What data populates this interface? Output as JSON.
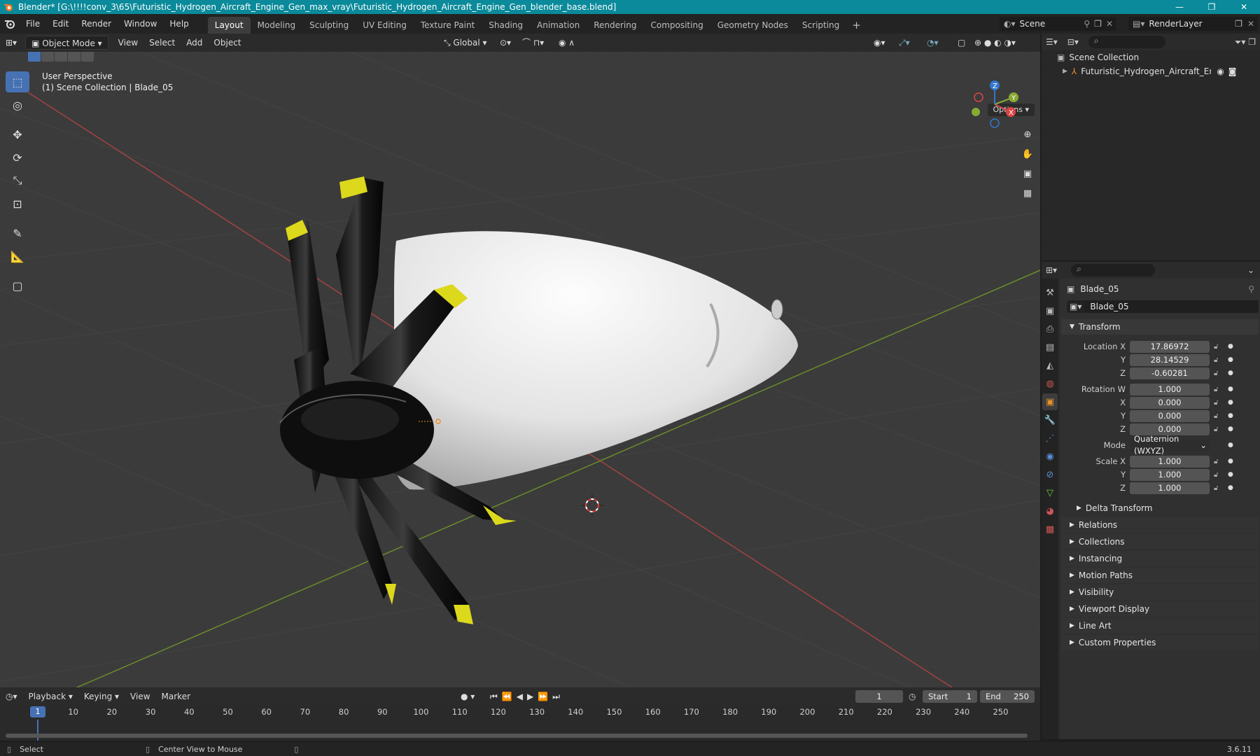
{
  "window": {
    "title": "Blender* [G:\\!!!!conv_3\\65\\Futuristic_Hydrogen_Aircraft_Engine_Gen_max_vray\\Futuristic_Hydrogen_Aircraft_Engine_Gen_blender_base.blend]"
  },
  "menu": [
    "File",
    "Edit",
    "Render",
    "Window",
    "Help"
  ],
  "workspaces": [
    "Layout",
    "Modeling",
    "Sculpting",
    "UV Editing",
    "Texture Paint",
    "Shading",
    "Animation",
    "Rendering",
    "Compositing",
    "Geometry Nodes",
    "Scripting"
  ],
  "active_workspace": "Layout",
  "scene": {
    "name": "Scene",
    "view_layer": "RenderLayer"
  },
  "viewport_header": {
    "mode": "Object Mode",
    "menus": [
      "View",
      "Select",
      "Add",
      "Object"
    ],
    "orientation": "Global",
    "options": "Options"
  },
  "viewport": {
    "perspective": "User Perspective",
    "collection_path": "(1) Scene Collection | Blade_05",
    "gizmo_axes": [
      "X",
      "Y",
      "Z"
    ]
  },
  "outliner": {
    "root": "Scene Collection",
    "item": "Futuristic_Hydrogen_Aircraft_Engine_Ge"
  },
  "properties": {
    "object_name": "Blade_05",
    "data_name": "Blade_05",
    "transform_label": "Transform",
    "location": {
      "label": "Location X",
      "x": "17.86972",
      "y": "28.14529",
      "z": "-0.60281"
    },
    "rotation": {
      "label": "Rotation W",
      "w": "1.000",
      "x": "0.000",
      "y": "0.000",
      "z": "0.000"
    },
    "mode_label": "Mode",
    "mode_value": "Quaternion (WXYZ)",
    "scale": {
      "label": "Scale X",
      "x": "1.000",
      "y": "1.000",
      "z": "1.000"
    },
    "axis_labels": {
      "y": "Y",
      "z": "Z",
      "x": "X"
    },
    "delta": "Delta Transform",
    "panels": [
      "Relations",
      "Collections",
      "Instancing",
      "Motion Paths",
      "Visibility",
      "Viewport Display",
      "Line Art",
      "Custom Properties"
    ]
  },
  "timeline": {
    "menus": [
      "Playback",
      "Keying",
      "View",
      "Marker"
    ],
    "current_frame": "1",
    "start_label": "Start",
    "start": "1",
    "end_label": "End",
    "end": "250",
    "ticks": [
      "1",
      "10",
      "20",
      "30",
      "40",
      "50",
      "60",
      "70",
      "80",
      "90",
      "100",
      "110",
      "120",
      "130",
      "140",
      "150",
      "160",
      "170",
      "180",
      "190",
      "200",
      "210",
      "220",
      "230",
      "240",
      "250"
    ]
  },
  "status": {
    "select": "Select",
    "center": "Center View to Mouse",
    "version": "3.6.11"
  },
  "colors": {
    "accent": "#4672b4",
    "titlebar": "#0a8a9a",
    "x_axis": "#c84646",
    "y_axis": "#7aaa2a"
  }
}
